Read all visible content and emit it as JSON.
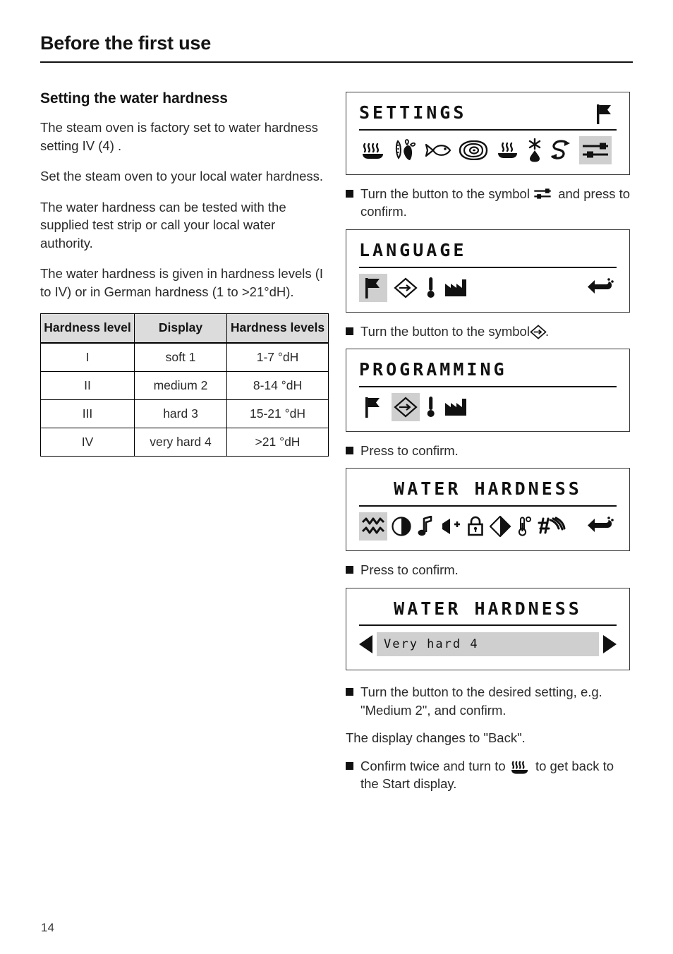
{
  "header": {
    "title": "Before the first use"
  },
  "left": {
    "section_title": "Setting the water hardness",
    "paragraphs": [
      "The steam oven is factory set to water hardness setting IV (4) .",
      "Set the steam oven to your local water hardness.",
      "The water hardness can be tested with the supplied test strip or call your local water authority.",
      "The water hardness is given in hardness levels (I to IV) or in German hardness (1 to >21°dH)."
    ],
    "table": {
      "headers": [
        "Hardness level",
        "Display",
        "Hardness levels"
      ],
      "rows": [
        [
          "I",
          "soft 1",
          "1-7 °dH"
        ],
        [
          "II",
          "medium 2",
          "8-14 °dH"
        ],
        [
          "III",
          "hard 3",
          "15-21 °dH"
        ],
        [
          "IV",
          "very hard 4",
          ">21 °dH"
        ]
      ]
    }
  },
  "right": {
    "displays": {
      "settings": {
        "title": "SETTINGS",
        "header_icon": "flag-icon",
        "icons": [
          "steam-icon",
          "vegetables-icon",
          "fish-icon",
          "meat-icon",
          "reheat-icon",
          "defrost-drop-icon",
          "special-cycle-icon",
          "sliders-settings-icon"
        ],
        "selected_index": 7
      },
      "language": {
        "title": "LANGUAGE",
        "icons": [
          "flag-icon",
          "programming-diamond-icon",
          "thermometer-icon",
          "factory-icon"
        ],
        "selected_index": 0,
        "back_icon": "return-arrow-icon"
      },
      "programming": {
        "title": "PROGRAMMING",
        "icons": [
          "flag-icon",
          "programming-diamond-icon",
          "thermometer-icon",
          "factory-icon"
        ],
        "selected_index": 1
      },
      "water_hardness_menu": {
        "title": "WATER  HARDNESS",
        "icons": [
          "water-hardness-icon",
          "contrast-icon",
          "buzzer-note-icon",
          "volume-up-icon",
          "lock-icon",
          "brightness-diamond-icon",
          "temperature-unit-icon",
          "descale-icon"
        ],
        "selected_index": 0,
        "back_icon": "return-arrow-icon"
      },
      "water_hardness_value": {
        "title": "WATER  HARDNESS",
        "left_arrow": "previous-value-arrow",
        "right_arrow": "next-value-arrow",
        "value": "Very hard 4"
      }
    },
    "steps": {
      "step1_a": "Turn the button to the symbol",
      "step1_b": "and press to confirm.",
      "step2_a": "Turn the button to the symbol",
      "step2_b": ".",
      "step3": "Press to confirm.",
      "step4": "Press to confirm.",
      "step5": "Turn the button to the desired setting, e.g. \"Medium 2\", and confirm.",
      "note": "The display changes to \"Back\".",
      "step6_a": "Confirm twice and turn to",
      "step6_b": "to get back to the Start display."
    }
  },
  "footer": {
    "page_number": "14"
  },
  "colors": {
    "selection_highlight": "#cfcfcf",
    "table_header_bg": "#dcdcdc",
    "ink": "#111111"
  }
}
